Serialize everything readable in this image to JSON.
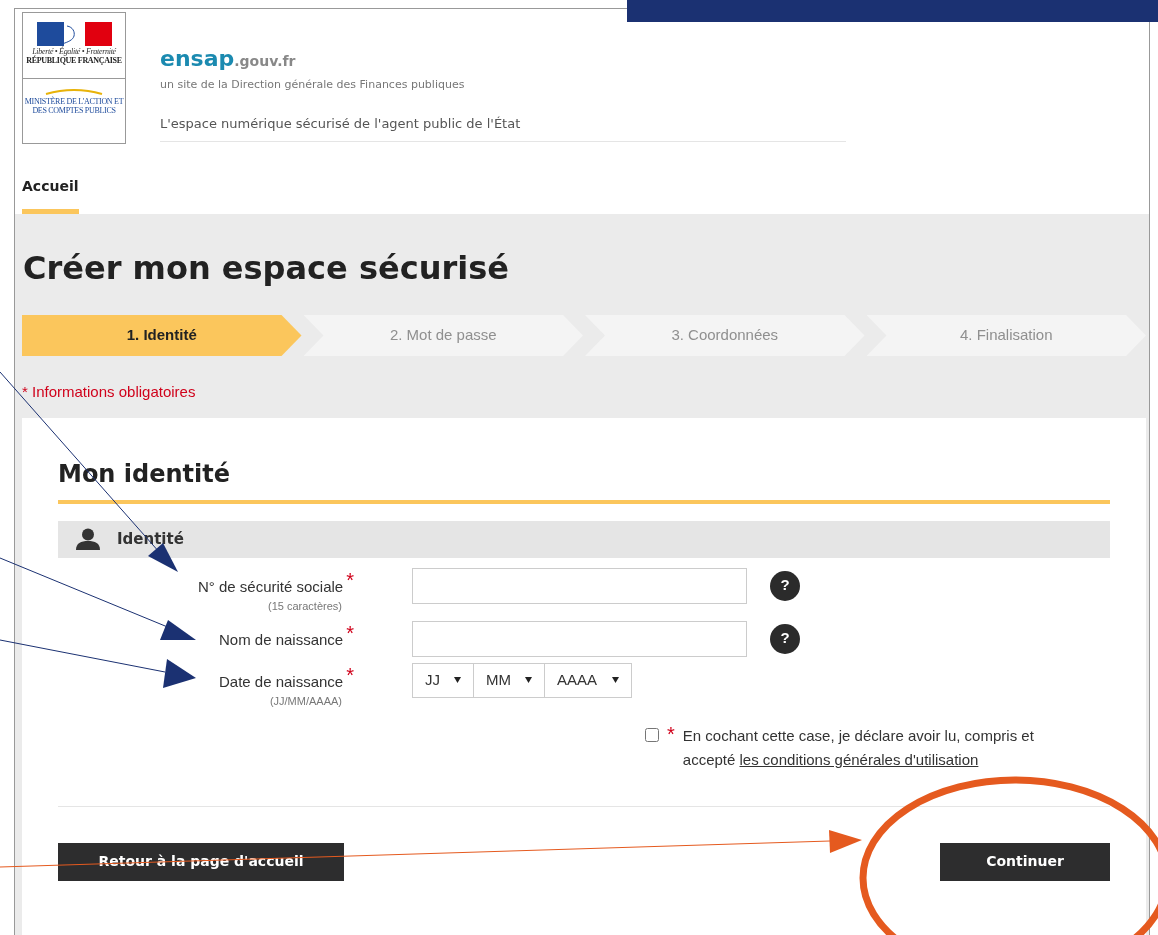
{
  "logo": {
    "motto": "Liberté • Égalité • Fraternité",
    "republic": "RÉPUBLIQUE FRANÇAISE",
    "ministry": "MINISTÈRE DE L'ACTION ET DES COMPTES PUBLICS"
  },
  "header": {
    "brand": "ensap",
    "domain": ".gouv.fr",
    "subtitle": "un site de la Direction générale des Finances publiques",
    "tagline": "L'espace numérique sécurisé de l'agent public de l'État"
  },
  "nav": [
    {
      "label": "Accueil",
      "selected": true
    }
  ],
  "page_title": "Créer mon espace sécurisé",
  "steps": [
    {
      "label": "1. Identité",
      "selected": true
    },
    {
      "label": "2. Mot de passe",
      "selected": false
    },
    {
      "label": "3. Coordonnées",
      "selected": false
    },
    {
      "label": "4. Finalisation",
      "selected": false
    }
  ],
  "required_note": "* Informations obligatoires",
  "section_title": "Mon identité",
  "panel_title": "Identité",
  "fields": [
    {
      "kind": "text",
      "label": "N° de sécurité sociale",
      "required_mark": "*",
      "hint": "(15 caractères)",
      "help": "?"
    },
    {
      "kind": "text",
      "label": "Nom de naissance",
      "required_mark": "*",
      "help": "?"
    },
    {
      "kind": "date",
      "label": "Date de naissance",
      "required_mark": "*",
      "hint": "(JJ/MM/AAAA)",
      "selects": [
        "JJ",
        "MM",
        "AAAA"
      ]
    }
  ],
  "consent": {
    "checked": false,
    "required_mark": "*",
    "text": "En cochant cette case, je déclare avoir lu, compris et accepté ",
    "link": "les conditions générales d'utilisation"
  },
  "buttons": {
    "back": "Retour à la page d'accueil",
    "next": "Continuer"
  }
}
